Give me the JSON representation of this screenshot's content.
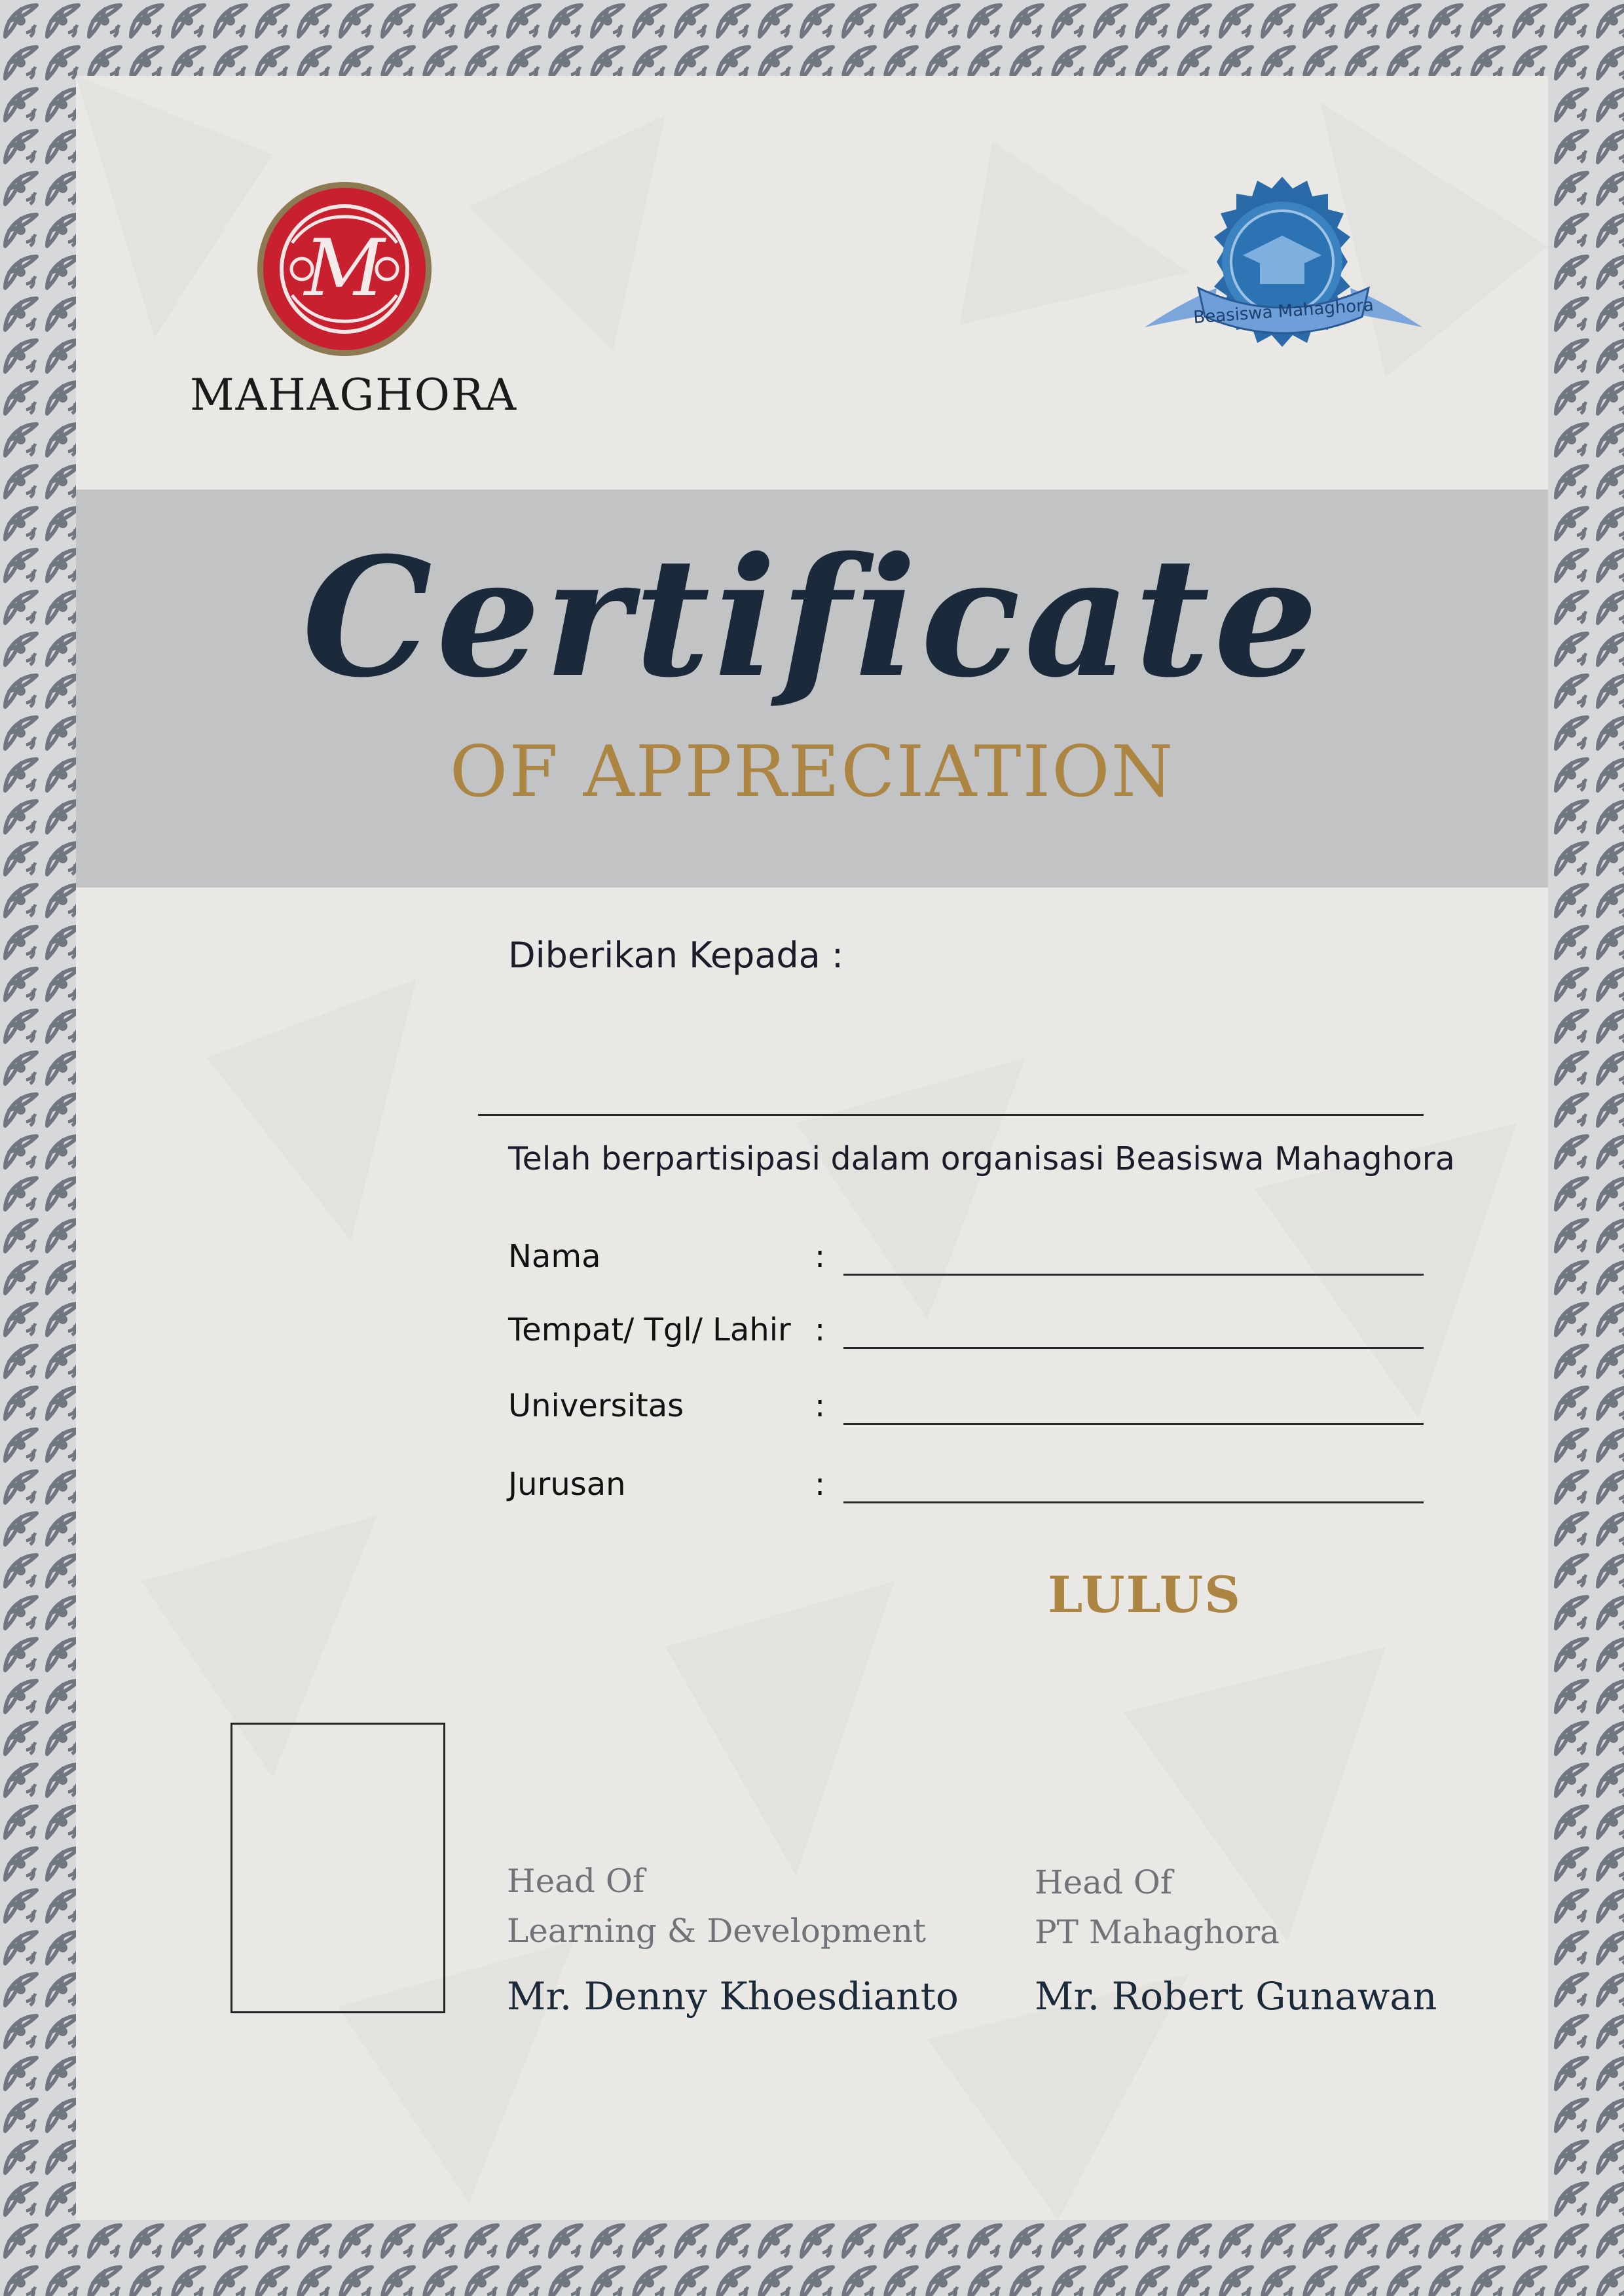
{
  "organization": {
    "logo_wordmark": "MAHAGHORA",
    "badge_text": "Beasiswa Mahaghora"
  },
  "certificate": {
    "title": "Certificate",
    "subtitle": "OF APPRECIATION"
  },
  "body": {
    "given_to_label": "Diberikan Kepada :",
    "participation_text": "Telah berpartisipasi dalam organisasi Beasiswa Mahaghora",
    "fields": [
      {
        "label": "Nama",
        "colon": ":"
      },
      {
        "label": "Tempat/ Tgl/ Lahir",
        "colon": ":"
      },
      {
        "label": "Universitas",
        "colon": ":"
      },
      {
        "label": "Jurusan",
        "colon": ":"
      }
    ],
    "status": "LULUS"
  },
  "signatories": [
    {
      "role_line1": "Head Of",
      "role_line2": "Learning & Development",
      "name": "Mr. Denny Khoesdianto"
    },
    {
      "role_line1": "Head Of",
      "role_line2": "PT Mahaghora",
      "name": "Mr. Robert Gunawan"
    }
  ],
  "colors": {
    "border": "#6f7680",
    "band": "#c2c3c4",
    "title": "#1b2a3b",
    "accent_gold": "#ad8542",
    "logo_red": "#c8202e",
    "badge_blue": "#2a6aa8"
  }
}
